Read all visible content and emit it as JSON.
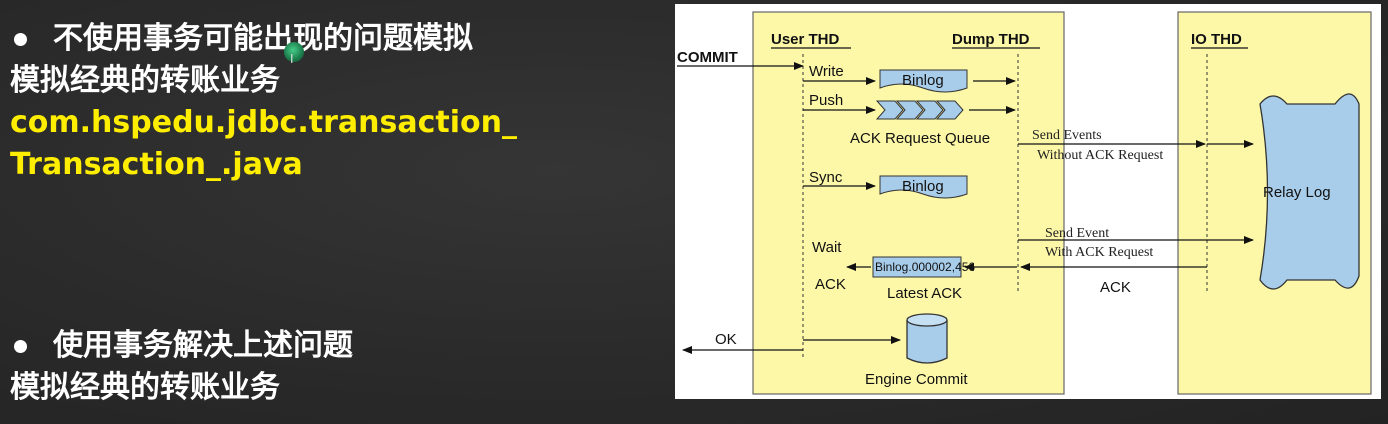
{
  "slide": {
    "bullet1_line1": "不使用事务可能出现的问题模拟",
    "bullet1_line2": "模拟经典的转账业务",
    "bullet1_code_line1": "com.hspedu.jdbc.transaction_",
    "bullet1_code_line2": "Transaction_.java",
    "bullet2_line1": "使用事务解决上述问题",
    "bullet2_line2": "模拟经典的转账业务"
  },
  "diagram": {
    "headers": {
      "user_thd": "User THD",
      "dump_thd": "Dump THD",
      "io_thd": "IO THD"
    },
    "commit_label": "COMMIT",
    "write_label": "Write",
    "push_label": "Push",
    "sync_label": "Sync",
    "wait_label": "Wait",
    "ack_left_label": "ACK",
    "ok_label": "OK",
    "binlog_top": "Binlog",
    "binlog_sync": "Binlog",
    "ack_queue_label": "ACK Request Queue",
    "send_events_line1": "Send Events",
    "send_events_line2": "Without ACK Request",
    "send_event_line1": "Send Event",
    "send_event_line2": "With ACK Request",
    "binlog_position": "Binlog.000002,456",
    "latest_ack_label": "Latest ACK",
    "ack_right_label": "ACK",
    "relay_log_label": "Relay Log",
    "engine_commit_label": "Engine Commit"
  },
  "colors": {
    "lane_fill": "#fdf8a8",
    "box_fill": "#a8cdea",
    "bullet_text": "#ffffff",
    "code_text": "#ffee00"
  }
}
